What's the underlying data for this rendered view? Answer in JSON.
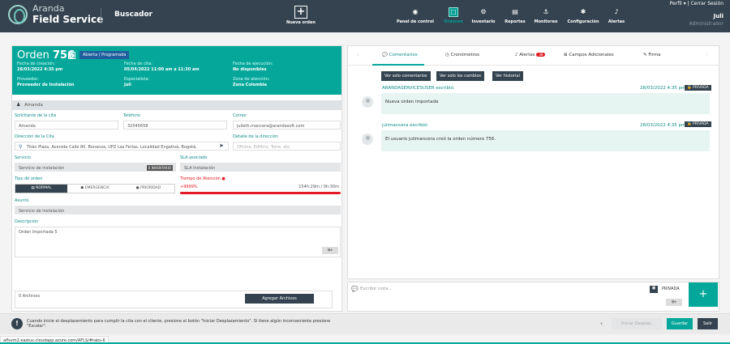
{
  "header": {
    "brand_line1": "Aranda",
    "brand_line2": "Field Service",
    "section": "Buscador",
    "new_order_label": "Nueva orden",
    "nav": [
      {
        "label": "Panel de control",
        "icon": "dashboard-icon",
        "glyph": "◉"
      },
      {
        "label": "Órdenes",
        "icon": "orders-icon",
        "glyph": "☐",
        "active": true
      },
      {
        "label": "Inventario",
        "icon": "inventory-icon",
        "glyph": "⚙"
      },
      {
        "label": "Reportes",
        "icon": "reports-icon",
        "glyph": "▤"
      },
      {
        "label": "Monitoreo",
        "icon": "monitoring-icon",
        "glyph": "⚓"
      },
      {
        "label": "Configuración",
        "icon": "settings-icon",
        "glyph": "✱"
      },
      {
        "label": "Alertas",
        "icon": "bell-icon",
        "glyph": "🔔"
      }
    ],
    "profile_label": "Perfil",
    "logout_label": "Cerrar Sesión",
    "user": "Juli",
    "role": "Administrador"
  },
  "order": {
    "title": "Orden",
    "number": "756",
    "badge": "R",
    "status": "Abierta / Programada",
    "creation_label": "Fecha de creación:",
    "creation_value": "28/03/2022 4:35 pm",
    "appointment_label": "Fecha de cita:",
    "appointment_value": "05/04/2022 11:00 am a 11:30 am",
    "execution_label": "Fecha de ejecución:",
    "execution_value": "No disponibles",
    "provider_label": "Proveedor:",
    "provider_value": "Proveedor de Instalación",
    "specialist_label": "Especialista:",
    "specialist_value": "Juli",
    "zone_label": "Zona de atención:",
    "zone_value": "Zona Colombia"
  },
  "contact": {
    "name": "Amanda",
    "requester_label": "Solicitante de la cita",
    "requester_value": "Amanda",
    "phone_label": "Teléfono",
    "phone_value": "32045658",
    "email_label": "Correo",
    "email_value": "julieth.mancera@arandasoft.com",
    "address_label": "Dirección de la Cita",
    "address_value": "Titán Plaza, Avenida Calle 80, Bonanza, UPZ Las Ferias, Localidad Engativá, Bogotá,",
    "address_detail_label": "Detalle de la dirección",
    "address_detail_placeholder": "Oficina, Edificio, Torre, etc.",
    "service_label": "Servicio",
    "service_value": "Servicio de instalación",
    "inventory_tag": "0 INVENTARIO",
    "sla_label": "SLA asociado",
    "sla_value": "SLA Instalación",
    "order_type_label": "Tipo de orden",
    "types": [
      "NORMAL",
      "EMERGENCIA",
      "PRIORIDAD"
    ],
    "attention_label": "Tiempo de Atención",
    "attention_pct": "+9999%",
    "attention_time": "154h:29m / 0h:30m",
    "subject_label": "Asunto",
    "subject_value": "Servicio de instalación",
    "description_label": "Descripción",
    "description_value": "Orden Importada 5",
    "attachments_label": "0 Archivos",
    "add_files": "Agregar Archivos"
  },
  "comments": {
    "tabs": [
      "Comentarios",
      "Cronómetros",
      "Alertas",
      "Campos Adicionales",
      "Firma"
    ],
    "alert_count": "38",
    "filters": [
      "Ver solo comentarios",
      "Ver solo los cambios",
      "Ver historial"
    ],
    "private_label": "PRIVADA",
    "items": [
      {
        "author": "ARANDASERVICESUSER escribió:",
        "time": "28/03/2022 4:35 pm",
        "text": "Nueva orden importada"
      },
      {
        "author": "julimancera escribió:",
        "time": "28/03/2022 4:35 pm",
        "text": "El usuario julimancera creó la orden número 756."
      }
    ],
    "note_placeholder": "Escribir nota..."
  },
  "footer": {
    "hint": "Cuando inicie el desplazamiento para cumplir la cita con el cliente, presione el botón \"Iniciar Desplazamiento\". Si tiene algún inconveniente presione \"Escalar\".",
    "start_travel": "Iniciar Desplaz.",
    "save": "Guardar",
    "exit": "Salir",
    "url": "aflsvm2.eastus.cloudapp.azure.com/AFLS/#tabs-6"
  },
  "colors": {
    "teal": "#05a79a",
    "topbar": "#34434f",
    "red": "#e21b24"
  }
}
